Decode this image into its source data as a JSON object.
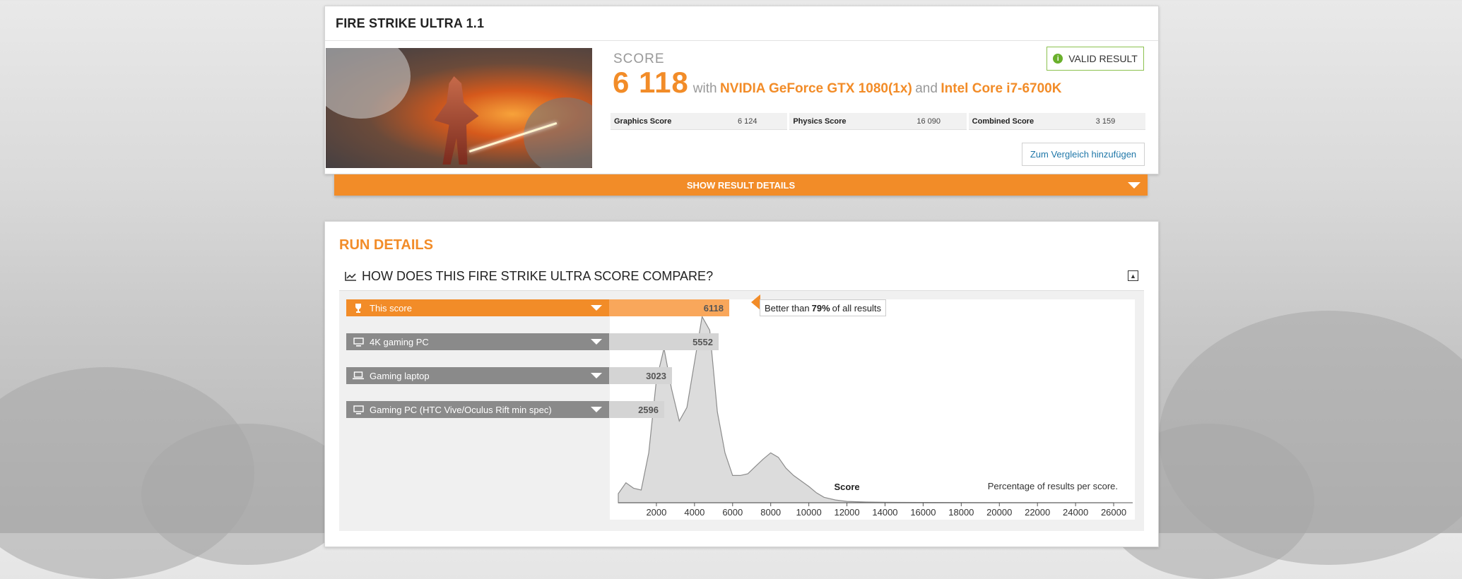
{
  "result": {
    "title": "FIRE STRIKE ULTRA 1.1",
    "score_label": "SCORE",
    "score": "6 118",
    "with_word": "with",
    "gpu": "NVIDIA GeForce GTX 1080(1x)",
    "and_word": "and",
    "cpu": "Intel Core i7-6700K",
    "valid_label": "VALID RESULT",
    "valid_icon": "info-icon",
    "subscores": [
      {
        "label": "Graphics Score",
        "value": "6 124"
      },
      {
        "label": "Physics Score",
        "value": "16 090"
      },
      {
        "label": "Combined Score",
        "value": "3 159"
      }
    ],
    "compare_button": "Zum Vergleich hinzufügen",
    "details_bar": "SHOW RESULT DETAILS"
  },
  "run": {
    "title": "RUN DETAILS",
    "compare_title": "HOW DOES THIS FIRE STRIKE ULTRA SCORE COMPARE?",
    "better_prefix": "Better than",
    "better_pct": "79%",
    "better_suffix": "of all results",
    "rows": [
      {
        "label": "This score",
        "value": "6118",
        "icon": "trophy-icon",
        "color": "#f28c28",
        "bar_color": "#f9a75b"
      },
      {
        "label": "4K gaming PC",
        "value": "5552",
        "icon": "desktop-icon",
        "color": "#8a8a8a",
        "bar_color": "#d4d4d4"
      },
      {
        "label": "Gaming laptop",
        "value": "3023",
        "icon": "laptop-icon",
        "color": "#8a8a8a",
        "bar_color": "#d4d4d4"
      },
      {
        "label": "Gaming PC (HTC Vive/Oculus Rift min spec)",
        "value": "2596",
        "icon": "desktop-icon",
        "color": "#8a8a8a",
        "bar_color": "#d4d4d4"
      }
    ]
  },
  "chart_data": {
    "type": "area",
    "xlabel": "Score",
    "annotation": "Percentage of results per score.",
    "xlim": [
      0,
      27000
    ],
    "x_ticks": [
      2000,
      4000,
      6000,
      8000,
      10000,
      12000,
      14000,
      16000,
      18000,
      20000,
      22000,
      24000,
      26000
    ],
    "series": [
      {
        "x": [
          0,
          400,
          800,
          1200,
          1600,
          2000,
          2400,
          2800,
          3200,
          3600,
          4000,
          4400,
          4800,
          5200,
          5600,
          6000,
          6400,
          6800,
          7200,
          7600,
          8000,
          8400,
          8800,
          9200,
          9600,
          10000,
          10400,
          10800,
          11400,
          12000,
          13000,
          14000,
          16000,
          20000,
          26000
        ],
        "y": [
          1.0,
          2.2,
          1.6,
          1.4,
          5.5,
          13.5,
          17.0,
          12.5,
          9.0,
          10.5,
          15.5,
          20.5,
          19.0,
          10.0,
          5.5,
          3.0,
          3.0,
          3.2,
          4.0,
          4.8,
          5.5,
          5.0,
          3.8,
          3.0,
          2.4,
          1.8,
          1.1,
          0.6,
          0.3,
          0.15,
          0.08,
          0.05,
          0.03,
          0.01,
          0.0
        ]
      }
    ]
  }
}
